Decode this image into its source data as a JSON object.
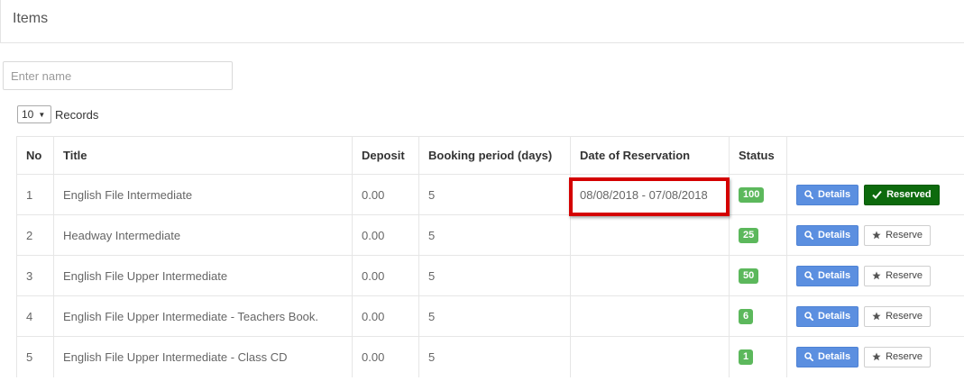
{
  "header": {
    "title": "Items"
  },
  "search": {
    "placeholder": "Enter name",
    "value": ""
  },
  "records": {
    "selected": "10",
    "label": "Records"
  },
  "table": {
    "columns": {
      "no": "No",
      "title": "Title",
      "deposit": "Deposit",
      "period": "Booking period (days)",
      "date": "Date of Reservation",
      "status": "Status"
    },
    "rows": [
      {
        "no": "1",
        "title": "English File Intermediate",
        "deposit": "0.00",
        "period": "5",
        "date": "08/08/2018 - 07/08/2018",
        "status": "100",
        "details_label": "Details",
        "reserve_label": "Reserved",
        "reserved": true
      },
      {
        "no": "2",
        "title": "Headway Intermediate",
        "deposit": "0.00",
        "period": "5",
        "date": "",
        "status": "25",
        "details_label": "Details",
        "reserve_label": "Reserve",
        "reserved": false
      },
      {
        "no": "3",
        "title": "English File Upper Intermediate",
        "deposit": "0.00",
        "period": "5",
        "date": "",
        "status": "50",
        "details_label": "Details",
        "reserve_label": "Reserve",
        "reserved": false
      },
      {
        "no": "4",
        "title": "English File Upper Intermediate - Teachers Book.",
        "deposit": "0.00",
        "period": "5",
        "date": "",
        "status": "6",
        "details_label": "Details",
        "reserve_label": "Reserve",
        "reserved": false
      },
      {
        "no": "5",
        "title": "English File Upper Intermediate - Class CD",
        "deposit": "0.00",
        "period": "5",
        "date": "",
        "status": "1",
        "details_label": "Details",
        "reserve_label": "Reserve",
        "reserved": false
      }
    ]
  },
  "colors": {
    "details_button": "#5b8fe0",
    "reserved_button": "#0d6a0d",
    "status_badge": "#5cb85c",
    "highlight": "#d40000"
  },
  "icons": {
    "details": "search-icon",
    "reserved": "check-icon",
    "reserve": "star-icon"
  }
}
